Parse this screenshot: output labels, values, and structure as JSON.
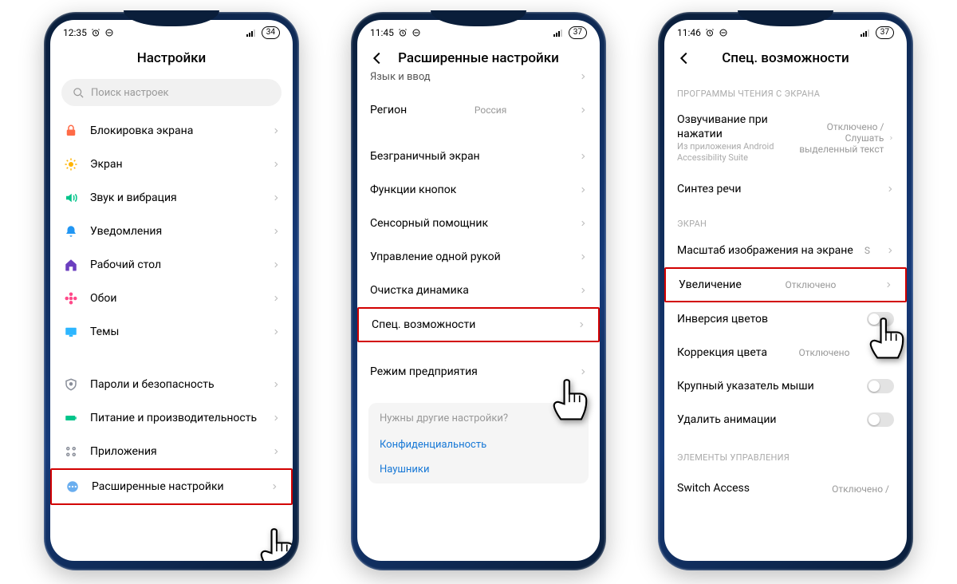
{
  "phone1": {
    "status": {
      "time": "12:35",
      "battery": "34"
    },
    "title": "Настройки",
    "search_placeholder": "Поиск настроек",
    "items_a": [
      {
        "icon": "lock",
        "color": "#ff6b47",
        "label": "Блокировка экрана"
      },
      {
        "icon": "sun",
        "color": "#ffb400",
        "label": "Экран"
      },
      {
        "icon": "sound",
        "color": "#00c48a",
        "label": "Звук и вибрация"
      },
      {
        "icon": "bell",
        "color": "#2196f3",
        "label": "Уведомления"
      },
      {
        "icon": "home",
        "color": "#6b3fbf",
        "label": "Рабочий стол"
      },
      {
        "icon": "flower",
        "color": "#ff4a8a",
        "label": "Обои"
      },
      {
        "icon": "themes",
        "color": "#2db6ff",
        "label": "Темы"
      }
    ],
    "items_b": [
      {
        "icon": "shield",
        "color": "#8a8f9a",
        "label": "Пароли и безопасность"
      },
      {
        "icon": "batt",
        "color": "#00c48a",
        "label": "Питание и производительность"
      },
      {
        "icon": "apps",
        "color": "#8a8f9a",
        "label": "Приложения"
      },
      {
        "icon": "more",
        "color": "#6aaeef",
        "label": "Расширенные настройки"
      }
    ]
  },
  "phone2": {
    "status": {
      "time": "11:45",
      "battery": "37"
    },
    "title": "Расширенные настройки",
    "items": [
      {
        "label": "Язык и ввод",
        "cut": true
      },
      {
        "label": "Регион",
        "value": "Россия"
      },
      {
        "spacer": true
      },
      {
        "label": "Безграничный экран"
      },
      {
        "label": "Функции кнопок"
      },
      {
        "label": "Сенсорный помощник"
      },
      {
        "label": "Управление одной рукой"
      },
      {
        "label": "Очистка динамика"
      },
      {
        "label": "Спец. возможности",
        "highlight": true
      },
      {
        "spacer": true
      },
      {
        "label": "Режим предприятия"
      }
    ],
    "footer": {
      "q": "Нужны другие настройки?",
      "links": [
        "Конфиденциальность",
        "Наушники"
      ]
    }
  },
  "phone3": {
    "status": {
      "time": "11:46",
      "battery": "37"
    },
    "title": "Спец. возможности",
    "section1": "ПРОГРАММЫ ЧТЕНИЯ С ЭКРАНА",
    "talkback": {
      "title": "Озвучивание при нажатии",
      "sub": "Из приложения Android Accessibility Suite",
      "value": "Отключено / Слушать выделенный текст"
    },
    "tts": "Синтез речи",
    "section2": "ЭКРАН",
    "items2": [
      {
        "label": "Масштаб изображения на экране",
        "value": "S"
      },
      {
        "label": "Увеличение",
        "value": "Отключено",
        "highlight": true
      },
      {
        "label": "Инверсия цветов",
        "toggle": true
      },
      {
        "label": "Коррекция цвета",
        "value": "Отключено"
      },
      {
        "label": "Крупный указатель мыши",
        "toggle": true
      },
      {
        "label": "Удалить анимации",
        "toggle": true
      }
    ],
    "section3": "ЭЛЕМЕНТЫ УПРАВЛЕНИЯ",
    "switch": {
      "label": "Switch Access",
      "value": "Отключено /"
    }
  }
}
